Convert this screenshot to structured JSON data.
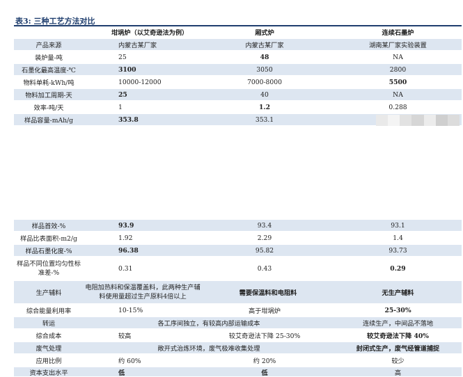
{
  "table": {
    "caption": "表3: 三种工艺方法对比",
    "headers": [
      "",
      "坩埚炉（以艾奇逊法为例）",
      "厢式炉",
      "连续石墨炉"
    ],
    "rows_top": [
      {
        "label": "产品来源",
        "c1": "内蒙古某厂家",
        "c2": "内蒙古某厂家",
        "c3": "湖南某厂家实验装置"
      },
      {
        "label": "装炉量-吨",
        "c1": "25",
        "c2": "48",
        "c3": "NA"
      },
      {
        "label": "石墨化最高温度-℃",
        "c1": "3100",
        "c2": "3050",
        "c3": "2800"
      },
      {
        "label": "物料单耗-kWh/吨",
        "c1": "10000-12000",
        "c2": "7000-8000",
        "c3": "5500"
      },
      {
        "label": "物料加工周期-天",
        "c1": "25",
        "c2": "40",
        "c3": "NA"
      },
      {
        "label": "效率-吨/天",
        "c1": "1",
        "c2": "1.2",
        "c3": "0.288"
      },
      {
        "label": "样品容量-mAh/g",
        "c1": "353.8",
        "c2": "353.1",
        "c3": ""
      }
    ],
    "rows_bottom": [
      {
        "label": "样品首效-%",
        "c1": "93.9",
        "c2": "93.4",
        "c3": "93.1"
      },
      {
        "label": "样品比表面积-m2/g",
        "c1": "1.92",
        "c2": "2.29",
        "c3": "1.4"
      },
      {
        "label": "样品石墨化度-%",
        "c1": "96.38",
        "c2": "95.82",
        "c3": "93.73"
      },
      {
        "label": "样品不同位置均匀性标准差-%",
        "c1": "0.31",
        "c2": "0.43",
        "c3": "0.29"
      },
      {
        "label": "生产辅料",
        "c1": "电阻加热料和保温覆盖料，此两种生产辅料使用量超过生产原料4倍以上",
        "c2": "需要保温料和电阻料",
        "c3": "无生产辅料"
      },
      {
        "label": "综合能量利用率",
        "c1": "10-15%",
        "c2": "高于坩埚炉",
        "c3": "25-30%"
      },
      {
        "label": "转运",
        "c12": "各工序间独立，有较高内部运输成本",
        "c3": "连续生产，中间品不落地"
      },
      {
        "label": "综合成本",
        "c1": "较高",
        "c2": "较艾奇逊法下降 25-30%",
        "c3": "较艾奇逊法下降 40%"
      },
      {
        "label": "废气处理",
        "c12": "敞开式治炼环境，废气极难收集处理",
        "c3": "封闭式生产，废气经管道捕捉"
      },
      {
        "label": "应用比例",
        "c1": "约 60%",
        "c2": "约 20%",
        "c3": "较少"
      },
      {
        "label": "资本支出水平",
        "c1": "低",
        "c2": "低",
        "c3": "高"
      }
    ]
  }
}
